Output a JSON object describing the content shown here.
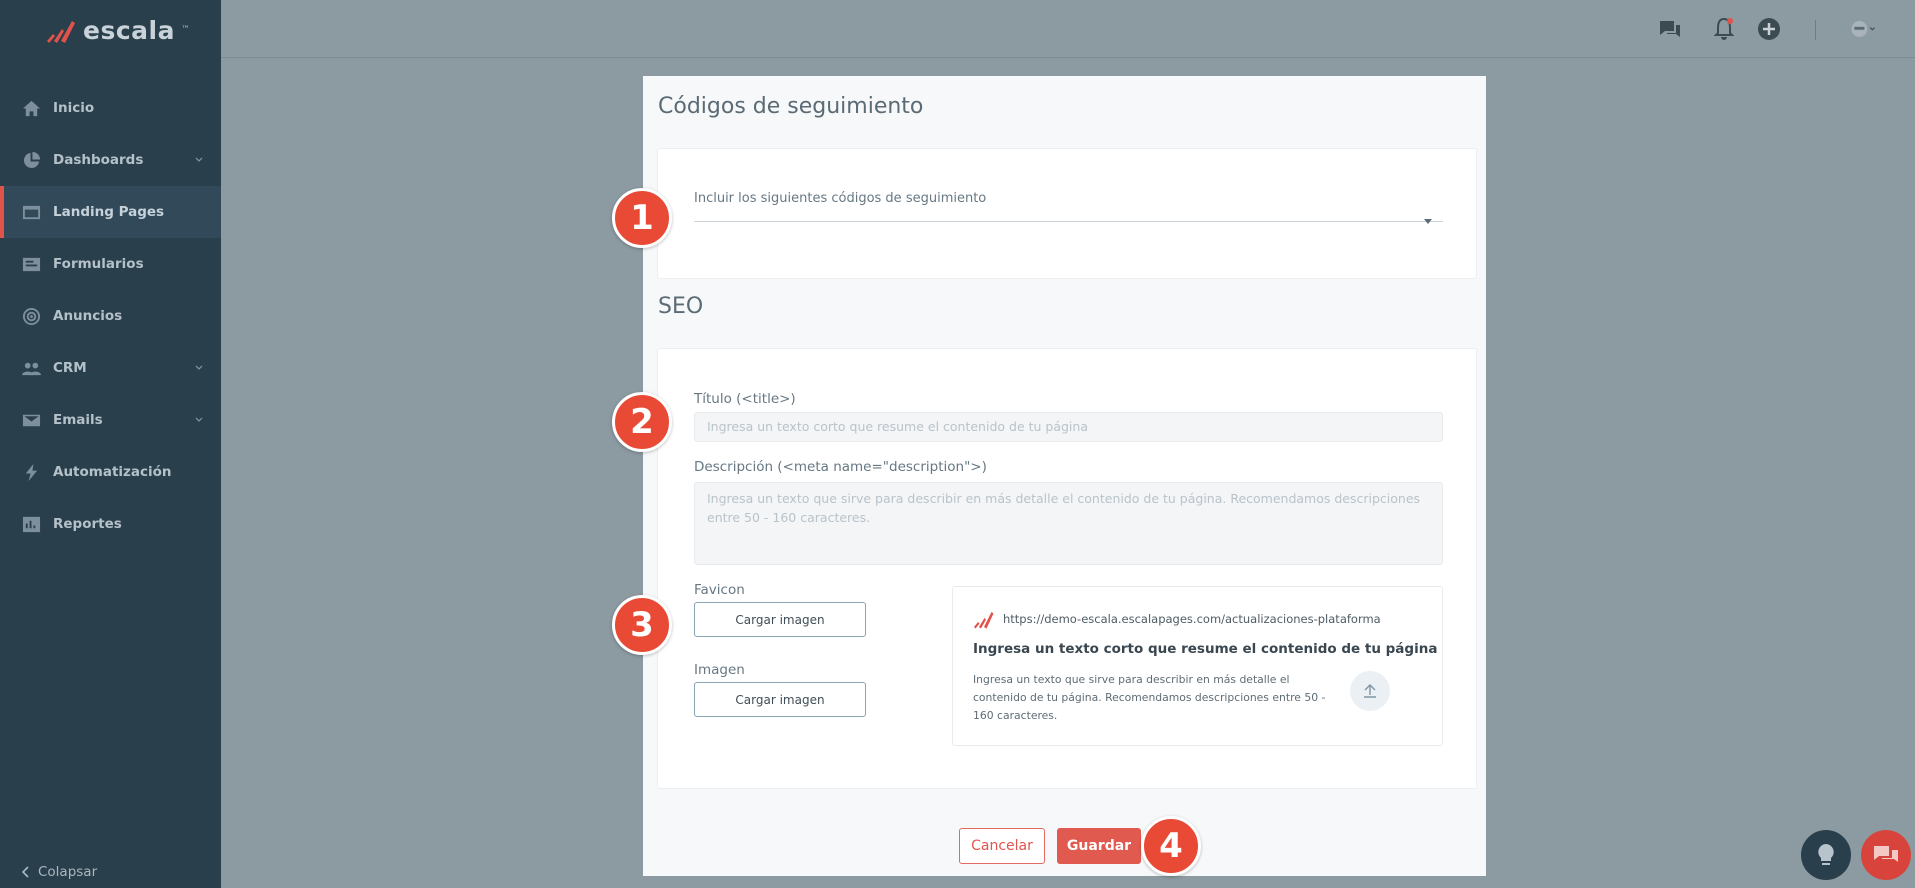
{
  "app": {
    "logo_text": "escala",
    "logo_mark": "™"
  },
  "sidebar": {
    "items": [
      {
        "label": "Inicio",
        "icon": "home-icon",
        "chevron": false,
        "active": false
      },
      {
        "label": "Dashboards",
        "icon": "pie-chart-icon",
        "chevron": true,
        "active": false
      },
      {
        "label": "Landing Pages",
        "icon": "browser-window-icon",
        "chevron": false,
        "active": true
      },
      {
        "label": "Formularios",
        "icon": "form-icon",
        "chevron": false,
        "active": false
      },
      {
        "label": "Anuncios",
        "icon": "target-icon",
        "chevron": false,
        "active": false
      },
      {
        "label": "CRM",
        "icon": "users-icon",
        "chevron": true,
        "active": false
      },
      {
        "label": "Emails",
        "icon": "envelope-icon",
        "chevron": true,
        "active": false
      },
      {
        "label": "Automatización",
        "icon": "lightning-icon",
        "chevron": false,
        "active": false
      },
      {
        "label": "Reportes",
        "icon": "report-icon",
        "chevron": false,
        "active": false
      }
    ],
    "collapse_label": "Colapsar"
  },
  "modal": {
    "tracking_title": "Códigos de seguimiento",
    "tracking_label": "Incluir los siguientes códigos de seguimiento",
    "tracking_value": "",
    "seo_title": "SEO",
    "title_label": "Título (<title>)",
    "title_placeholder": "Ingresa un texto corto que resume el contenido de tu página",
    "desc_label": "Descripción (<meta name=\"description\">)",
    "desc_placeholder": "Ingresa un texto que sirve para describir en más detalle el contenido de tu página. Recomendamos descripciones entre 50 - 160 caracteres.",
    "favicon_label": "Favicon",
    "favicon_button": "Cargar imagen",
    "image_label": "Imagen",
    "image_button": "Cargar imagen",
    "preview": {
      "url": "https://demo-escala.escalapages.com/actualizaciones-plataforma",
      "title": "Ingresa un texto corto que resume el contenido de tu página",
      "description": "Ingresa un texto que sirve para describir en más detalle el contenido de tu página. Recomendamos descripciones entre 50 - 160 caracteres."
    },
    "cancel_label": "Cancelar",
    "save_label": "Guardar"
  },
  "badges": [
    "1",
    "2",
    "3",
    "4"
  ],
  "colors": {
    "accent": "#e15a50",
    "badge": "#e84a36",
    "sidebar": "#2a3f4c"
  }
}
